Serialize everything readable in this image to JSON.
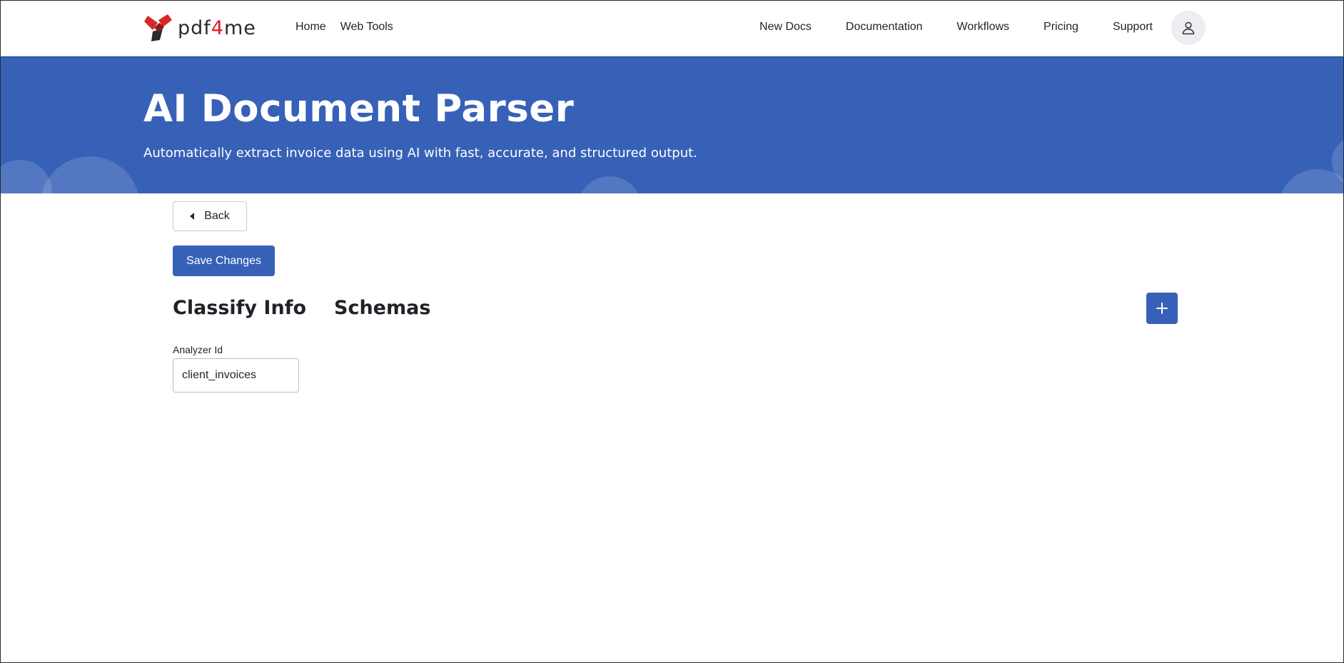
{
  "brand": {
    "logo_prefix": "pdf",
    "logo_four": "4",
    "logo_suffix": "me",
    "accent_color": "#3761b7",
    "logo_red": "#e01b24"
  },
  "nav": {
    "left": [
      {
        "label": "Home"
      },
      {
        "label": "Web Tools"
      }
    ],
    "right": [
      {
        "label": "New Docs"
      },
      {
        "label": "Documentation"
      },
      {
        "label": "Workflows"
      },
      {
        "label": "Pricing"
      },
      {
        "label": "Support"
      }
    ],
    "account_icon": "user-icon"
  },
  "hero": {
    "title": "AI Document Parser",
    "subtitle": "Automatically extract invoice data using AI with fast, accurate, and structured output."
  },
  "main": {
    "back_label": "Back",
    "save_label": "Save Changes",
    "classify_heading": "Classify Info",
    "schemas_heading": "Schemas",
    "add_icon": "plus-icon",
    "analyzer_field": {
      "label": "Analyzer Id",
      "value": "client_invoices"
    }
  }
}
